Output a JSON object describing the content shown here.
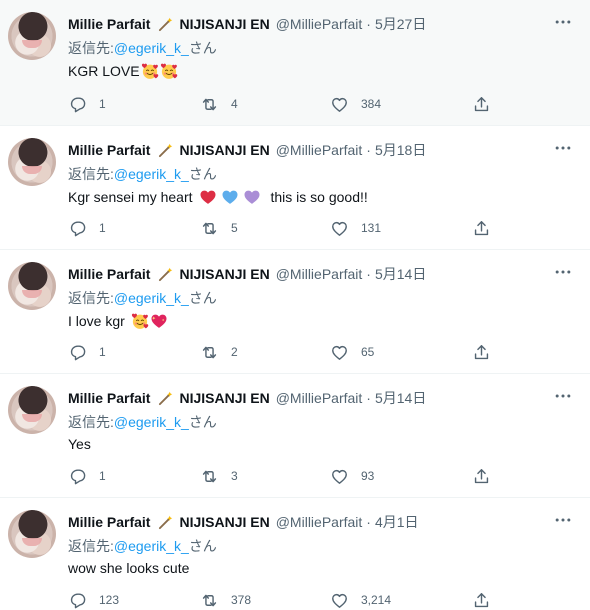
{
  "replying_prefix": "返信先:",
  "replying_suffix": "さん",
  "tweets": [
    {
      "author": "Millie Parfait",
      "org": "NIJISANJI EN",
      "handle": "@MillieParfait",
      "date": "5月27日",
      "mention": "@egerik_k_",
      "text": "KGR LOVE",
      "emoji_icons": [
        "smiling-face-with-hearts-icon",
        "smiling-face-with-hearts-icon"
      ],
      "replies": "1",
      "retweets": "4",
      "likes": "384"
    },
    {
      "author": "Millie Parfait",
      "org": "NIJISANJI EN",
      "handle": "@MillieParfait",
      "date": "5月18日",
      "mention": "@egerik_k_",
      "text_before": "Kgr sensei my heart",
      "text_after": "this is so good!!",
      "emoji_icons": [
        "red-heart-icon",
        "blue-heart-icon",
        "purple-heart-icon"
      ],
      "replies": "1",
      "retweets": "5",
      "likes": "131"
    },
    {
      "author": "Millie Parfait",
      "org": "NIJISANJI EN",
      "handle": "@MillieParfait",
      "date": "5月14日",
      "mention": "@egerik_k_",
      "text": "I love kgr",
      "emoji_icons": [
        "smiling-face-with-hearts-icon",
        "sparkling-heart-icon"
      ],
      "replies": "1",
      "retweets": "2",
      "likes": "65"
    },
    {
      "author": "Millie Parfait",
      "org": "NIJISANJI EN",
      "handle": "@MillieParfait",
      "date": "5月14日",
      "mention": "@egerik_k_",
      "text": "Yes",
      "replies": "1",
      "retweets": "3",
      "likes": "93"
    },
    {
      "author": "Millie Parfait",
      "org": "NIJISANJI EN",
      "handle": "@MillieParfait",
      "date": "4月1日",
      "mention": "@egerik_k_",
      "text": "wow she looks cute",
      "replies": "123",
      "retweets": "378",
      "likes": "3,214"
    }
  ],
  "icons": {
    "more": "more-options-icon",
    "reply": "reply-icon",
    "retweet": "retweet-icon",
    "like": "like-icon",
    "share": "share-icon",
    "wand": "magic-wand-icon"
  },
  "colors": {
    "accent": "#1d9bf0",
    "secondary_text": "#536471",
    "highlight_background": "#f7f9f9",
    "divider": "#eff3f4"
  }
}
